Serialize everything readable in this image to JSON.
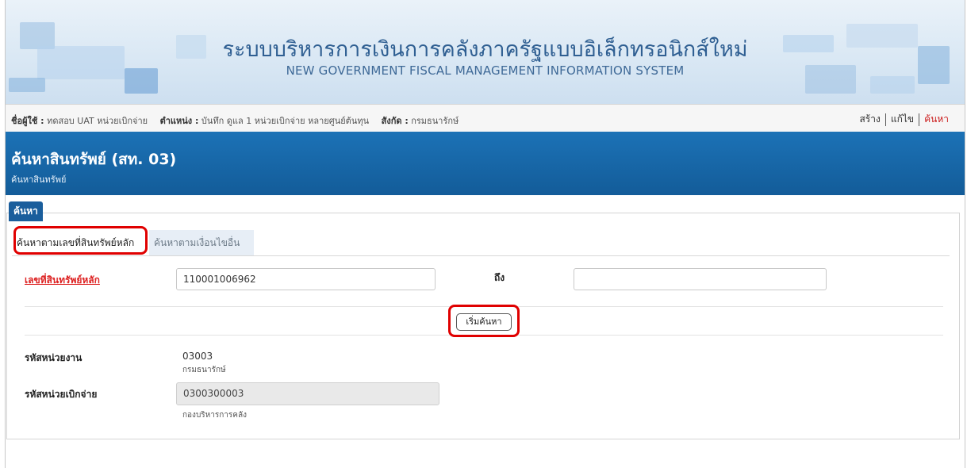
{
  "banner": {
    "title_th": "ระบบบริหารการเงินการคลังภาครัฐแบบอิเล็กทรอนิกส์ใหม่",
    "title_en": "NEW GOVERNMENT FISCAL MANAGEMENT INFORMATION SYSTEM"
  },
  "userbar": {
    "user_label": "ชื่อผู้ใช้ :",
    "user_value": "ทดสอบ UAT หน่วยเบิกจ่าย",
    "position_label": "ตำแหน่ง :",
    "position_value": "บันทึก ดูแล 1 หน่วยเบิกจ่าย หลายศูนย์ต้นทุน",
    "org_label": "สังกัด :",
    "org_value": "กรมธนารักษ์",
    "actions": {
      "create": "สร้าง",
      "edit": "แก้ไข",
      "search": "ค้นหา"
    }
  },
  "titlebar": {
    "title": "ค้นหาสินทรัพย์ (สท. 03)",
    "subtitle": "ค้นหาสินทรัพย์"
  },
  "panel": {
    "tag": "ค้นหา",
    "tabs": [
      {
        "label": "ค้นหาตามเลขที่สินทรัพย์หลัก",
        "active": true
      },
      {
        "label": "ค้นหาตามเงื่อนไขอื่น",
        "active": false
      }
    ],
    "asset_no": {
      "label": "เลขที่สินทรัพย์หลัก",
      "from_value": "110001006962",
      "to_label": "ถึง",
      "to_value": ""
    },
    "search_button": "เริ่มค้นหา",
    "agency_code": {
      "label": "รหัสหน่วยงาน",
      "value": "03003",
      "name": "กรมธนารักษ์"
    },
    "disbursing_unit": {
      "label": "รหัสหน่วยเบิกจ่าย",
      "value": "0300300003",
      "name": "กองบริหารการคลัง"
    }
  },
  "colors": {
    "banner_bg": "#dae8f4",
    "title_bar": "#1a69aa",
    "active_link": "#cc1f1f",
    "highlight": "#e00000"
  }
}
